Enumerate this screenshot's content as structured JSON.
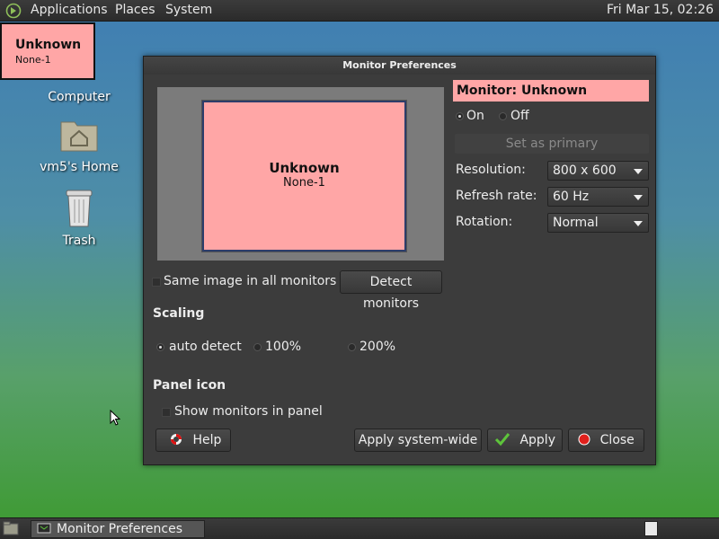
{
  "top_panel": {
    "menus": [
      "Applications",
      "Places",
      "System"
    ],
    "clock": "Fri Mar 15, 02:26"
  },
  "desktop": {
    "icons": [
      {
        "label": "Computer",
        "icon": "computer-icon"
      },
      {
        "label": "vm5's Home",
        "icon": "home-folder-icon"
      },
      {
        "label": "Trash",
        "icon": "trash-icon"
      }
    ]
  },
  "osd": {
    "name": "Unknown",
    "connector": "None-1"
  },
  "dialog": {
    "title": "Monitor Preferences",
    "monitor_preview": {
      "name": "Unknown",
      "connector": "None-1"
    },
    "monitor_label": "Monitor: Unknown",
    "power": {
      "on_label": "On",
      "off_label": "Off"
    },
    "set_primary_label": "Set as primary",
    "resolution": {
      "label": "Resolution:",
      "value": "800 x 600"
    },
    "refresh_rate": {
      "label": "Refresh rate:",
      "value": "60 Hz"
    },
    "rotation": {
      "label": "Rotation:",
      "value": "Normal"
    },
    "same_image_label": "Same image in all monitors",
    "detect_label": "Detect monitors",
    "scaling": {
      "heading": "Scaling",
      "options": [
        "auto detect",
        "100%",
        "200%"
      ],
      "selected": "auto detect"
    },
    "panel_icon": {
      "heading": "Panel icon",
      "show_label": "Show monitors in panel"
    },
    "buttons": {
      "help": "Help",
      "apply_system_wide": "Apply system-wide",
      "apply": "Apply",
      "close": "Close"
    },
    "colors": {
      "monitor_highlight": "#ffa6a6",
      "apply_check": "#5ec43b",
      "close_red": "#e0201c"
    }
  },
  "taskbar": {
    "window_label": "Monitor Preferences"
  }
}
